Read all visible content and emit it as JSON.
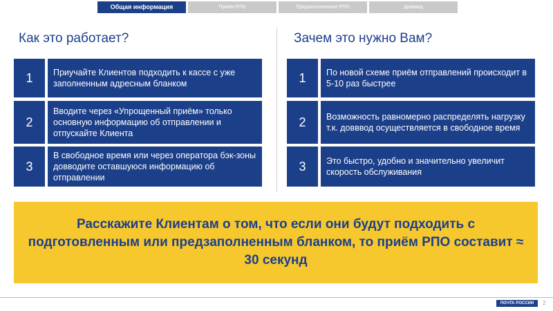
{
  "tabs": [
    {
      "label": "Общая информация"
    },
    {
      "label": "Приём РПО"
    },
    {
      "label": "Предзаполненные РПО"
    },
    {
      "label": "Довввод"
    }
  ],
  "left": {
    "title": "Как это работает?",
    "items": [
      {
        "num": "1",
        "text": "Приучайте Клиентов подходить к кассе с уже заполненным адресным бланком"
      },
      {
        "num": "2",
        "text": "Вводите через «Упрощенный приём» только основную информацию об отправлении и отпускайте Клиента"
      },
      {
        "num": "3",
        "text": "В свободное время или через оператора бэк-зоны довводите оставшуюся информацию об отправлении"
      }
    ]
  },
  "right": {
    "title": "Зачем это нужно Вам?",
    "items": [
      {
        "num": "1",
        "text": "По новой схеме приём отправлений происходит в 5-10 раз быстрее"
      },
      {
        "num": "2",
        "text": "Возможность равномерно распределять нагрузку т.к. довввод осуществляется в свободное время"
      },
      {
        "num": "3",
        "text": "Это быстро, удобно и значительно увеличит скорость обслуживания"
      }
    ]
  },
  "banner": {
    "text": "Расскажите Клиентам о том, что если они будут подходить с подготовленным или предзаполненным бланком, то приём РПО составит ≈ 30 секунд"
  },
  "footer": {
    "logo_text": "ПОЧТА РОССИИ",
    "page_number": "2"
  },
  "colors": {
    "brand_blue": "#1c3f8a",
    "banner_yellow": "#f6c82e",
    "tab_inactive": "#c9c9c9"
  }
}
